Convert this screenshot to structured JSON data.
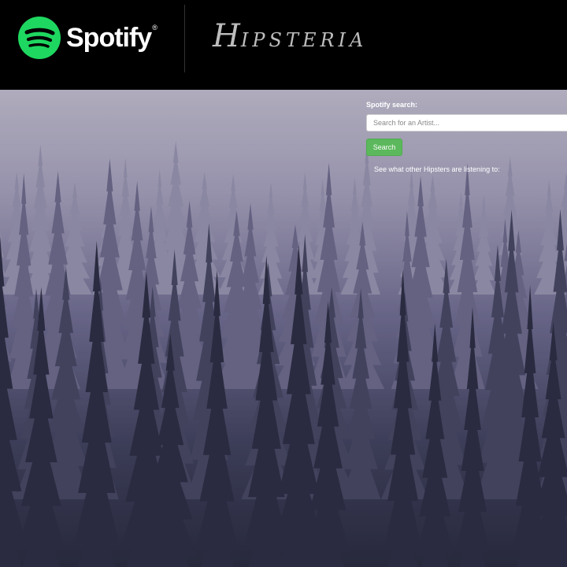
{
  "header": {
    "spotify_wordmark": "Spotify",
    "spotify_trademark": "®",
    "hipsteria_first_letter": "H",
    "hipsteria_rest": "IPSTERIA"
  },
  "search": {
    "label": "Spotify search:",
    "placeholder": "Search for an Artist...",
    "value": "",
    "button_label": "Search"
  },
  "feed": {
    "heading": "See what other Hipsters are listening to:"
  },
  "colors": {
    "header_bg": "#000000",
    "spotify_green": "#1ed760",
    "search_button": "#5cb85c",
    "sky_top": "#c9c4d3",
    "forest_dark": "#232436"
  },
  "icons": {
    "spotify_logo": "spotify-logo-icon",
    "background": "foggy-forest-image"
  }
}
